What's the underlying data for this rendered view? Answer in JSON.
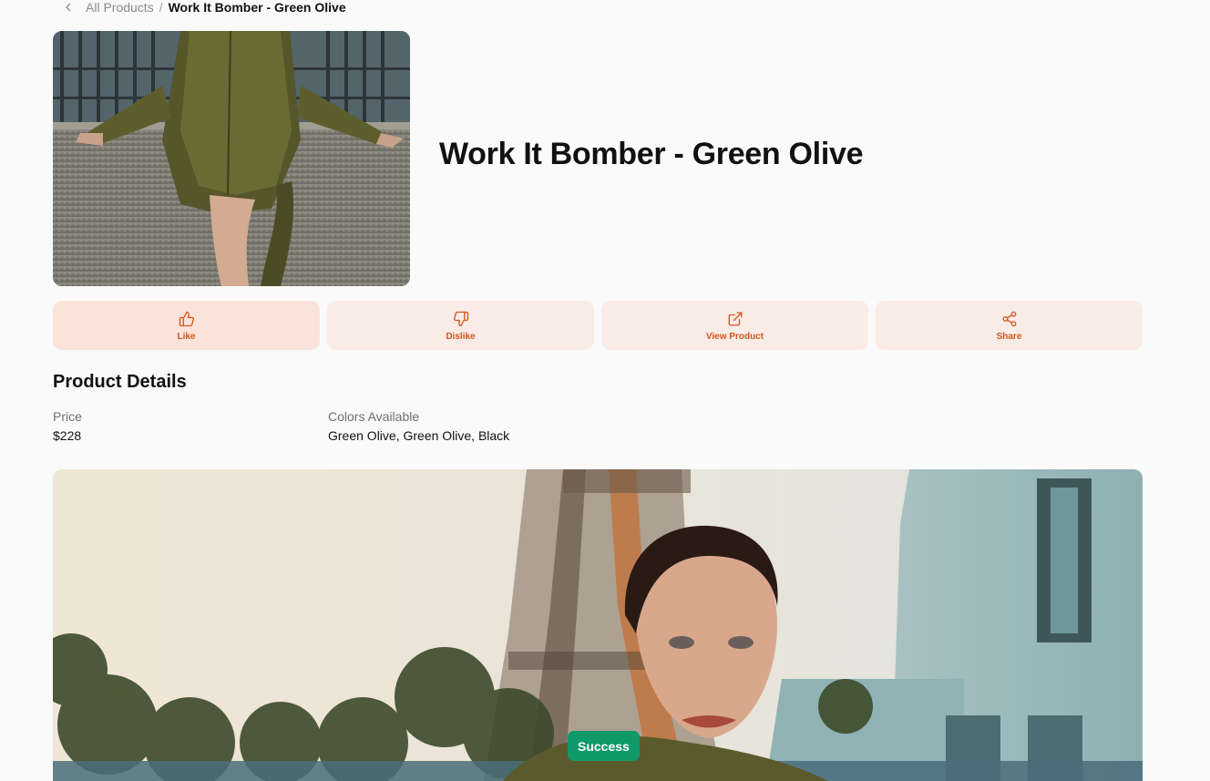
{
  "breadcrumb": {
    "parent": "All Products",
    "separator": "/",
    "current": "Work It Bomber - Green Olive"
  },
  "product": {
    "title": "Work It Bomber - Green Olive",
    "hero_image": "model-in-olive-bomber-sitting-on-wall",
    "gallery_image": "model-in-olive-bomber-near-eiffel-tower"
  },
  "actions": [
    {
      "label": "Like",
      "icon": "thumbs-up-icon"
    },
    {
      "label": "Dislike",
      "icon": "thumbs-down-icon"
    },
    {
      "label": "View Product",
      "icon": "external-link-icon"
    },
    {
      "label": "Share",
      "icon": "share-icon"
    }
  ],
  "details": {
    "title": "Product Details",
    "price_label": "Price",
    "price_value": "$228",
    "colors_label": "Colors Available",
    "colors_value": "Green Olive, Green Olive, Black"
  },
  "toast": {
    "text": "Success"
  },
  "colors": {
    "accent": "#d4561f",
    "button_bg": "#f9ece7",
    "button_bg_active": "#fae3da",
    "toast_bg": "#11996a",
    "page_bg": "#fafafa"
  }
}
